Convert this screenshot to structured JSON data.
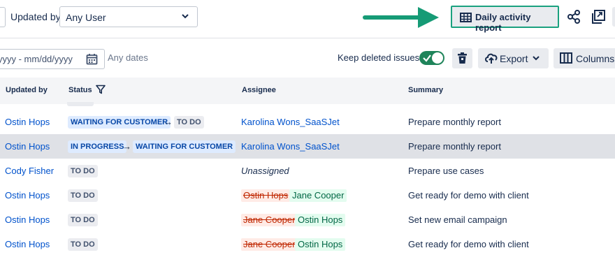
{
  "filters": {
    "updated_by_label": "Updated by:",
    "updated_by_value": "Any User",
    "date_placeholder": "yyyy - mm/dd/yyyy",
    "date_range_hint": "Any dates"
  },
  "toolbar": {
    "daily_report_label": "Daily activity report",
    "keep_deleted_label": "Keep deleted issues",
    "keep_deleted_on": true,
    "export_label": "Export",
    "columns_label": "Columns"
  },
  "table": {
    "headers": [
      "Updated by",
      "Status",
      "Assignee",
      "Summary"
    ],
    "rows": [
      {
        "updated_by": "Ostin Hops",
        "status_from": "WAITING FOR CUSTOMER",
        "status_to": "TO DO",
        "assignee": "Karolina Wons_SaaSJet",
        "summary": "Prepare monthly report"
      },
      {
        "updated_by": "Ostin Hops",
        "status_from": "IN PROGRESS",
        "status_to": "WAITING FOR CUSTOMER",
        "assignee": "Karolina Wons_SaaSJet",
        "summary": "Prepare monthly report"
      },
      {
        "updated_by": "Cody Fisher",
        "status": "TO DO",
        "assignee": "Unassigned",
        "summary": "Prepare use cases"
      },
      {
        "updated_by": "Ostin Hops",
        "status": "TO DO",
        "assignee_old": "Ostin Hops",
        "assignee_new": "Jane Cooper",
        "summary": "Get ready for demo with client"
      },
      {
        "updated_by": "Ostin Hops",
        "status": "TO DO",
        "assignee_old": "Jane Cooper",
        "assignee_new": "Ostin Hops",
        "summary": "Set new email campaign"
      },
      {
        "updated_by": "Ostin Hops",
        "status": "TO DO",
        "assignee_old": "Jane Cooper",
        "assignee_new": "Ostin Hops",
        "summary": "Get ready for demo with client"
      }
    ]
  },
  "colors": {
    "highlight_border": "#1aa17f",
    "callout_arrow": "#169b76",
    "link": "#0052cc",
    "toggle_on": "#1f845a"
  },
  "icons": [
    "chevron-down-icon",
    "table-grid-icon",
    "share-icon",
    "export-file-icon",
    "calendar-icon",
    "check-icon",
    "trash-icon",
    "cloud-upload-icon",
    "columns-icon",
    "filter-icon",
    "arrow-right-icon"
  ]
}
